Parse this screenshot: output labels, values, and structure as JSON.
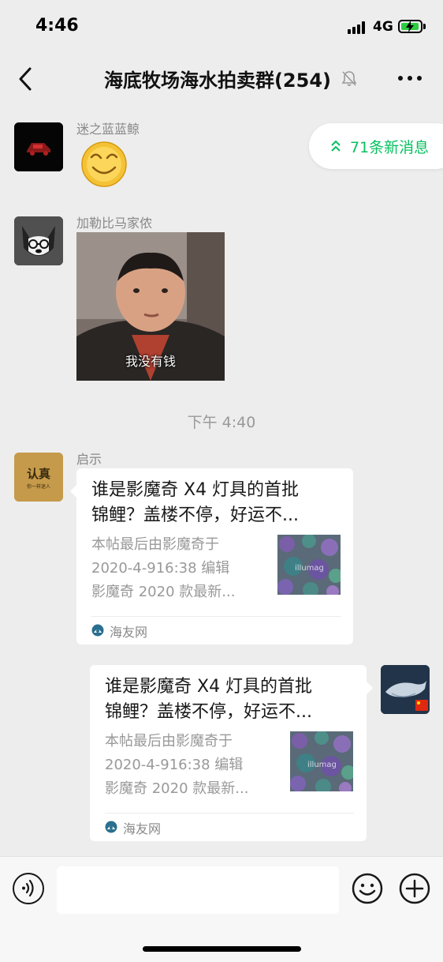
{
  "status_bar": {
    "time": "4:46",
    "network": "4G"
  },
  "nav": {
    "title": "海底牧场海水拍卖群(254)"
  },
  "new_messages": {
    "label": "71条新消息"
  },
  "messages": [
    {
      "sender": "迷之蓝蓝鲸",
      "type": "sticker",
      "icon": "smiley-emoji-icon"
    },
    {
      "sender": "加勒比马家侬",
      "type": "image",
      "caption": "我没有钱"
    }
  ],
  "time_divider": "下午 4:40",
  "cards": [
    {
      "sender": "启示",
      "title_line1": "谁是影魔奇 X4 灯具的首批",
      "title_line2": "锦鲤？盖楼不停，好运不...",
      "desc_line1": "本帖最后由影魔奇于",
      "desc_line2": "2020-4-916:38 编辑",
      "desc_line3": "影魔奇 2020 款最新...",
      "source": "海友网"
    },
    {
      "sender": "self",
      "title_line1": "谁是影魔奇 X4 灯具的首批",
      "title_line2": "锦鲤？盖楼不停，好运不...",
      "desc_line1": "本帖最后由影魔奇于",
      "desc_line2": "2020-4-916:38 编辑",
      "desc_line3": "影魔奇 2020 款最新...",
      "source": "海友网"
    }
  ],
  "input": {
    "placeholder": ""
  },
  "colors": {
    "accent": "#07c160",
    "background": "#ededed",
    "card": "#ffffff",
    "meta_text": "#999999"
  }
}
